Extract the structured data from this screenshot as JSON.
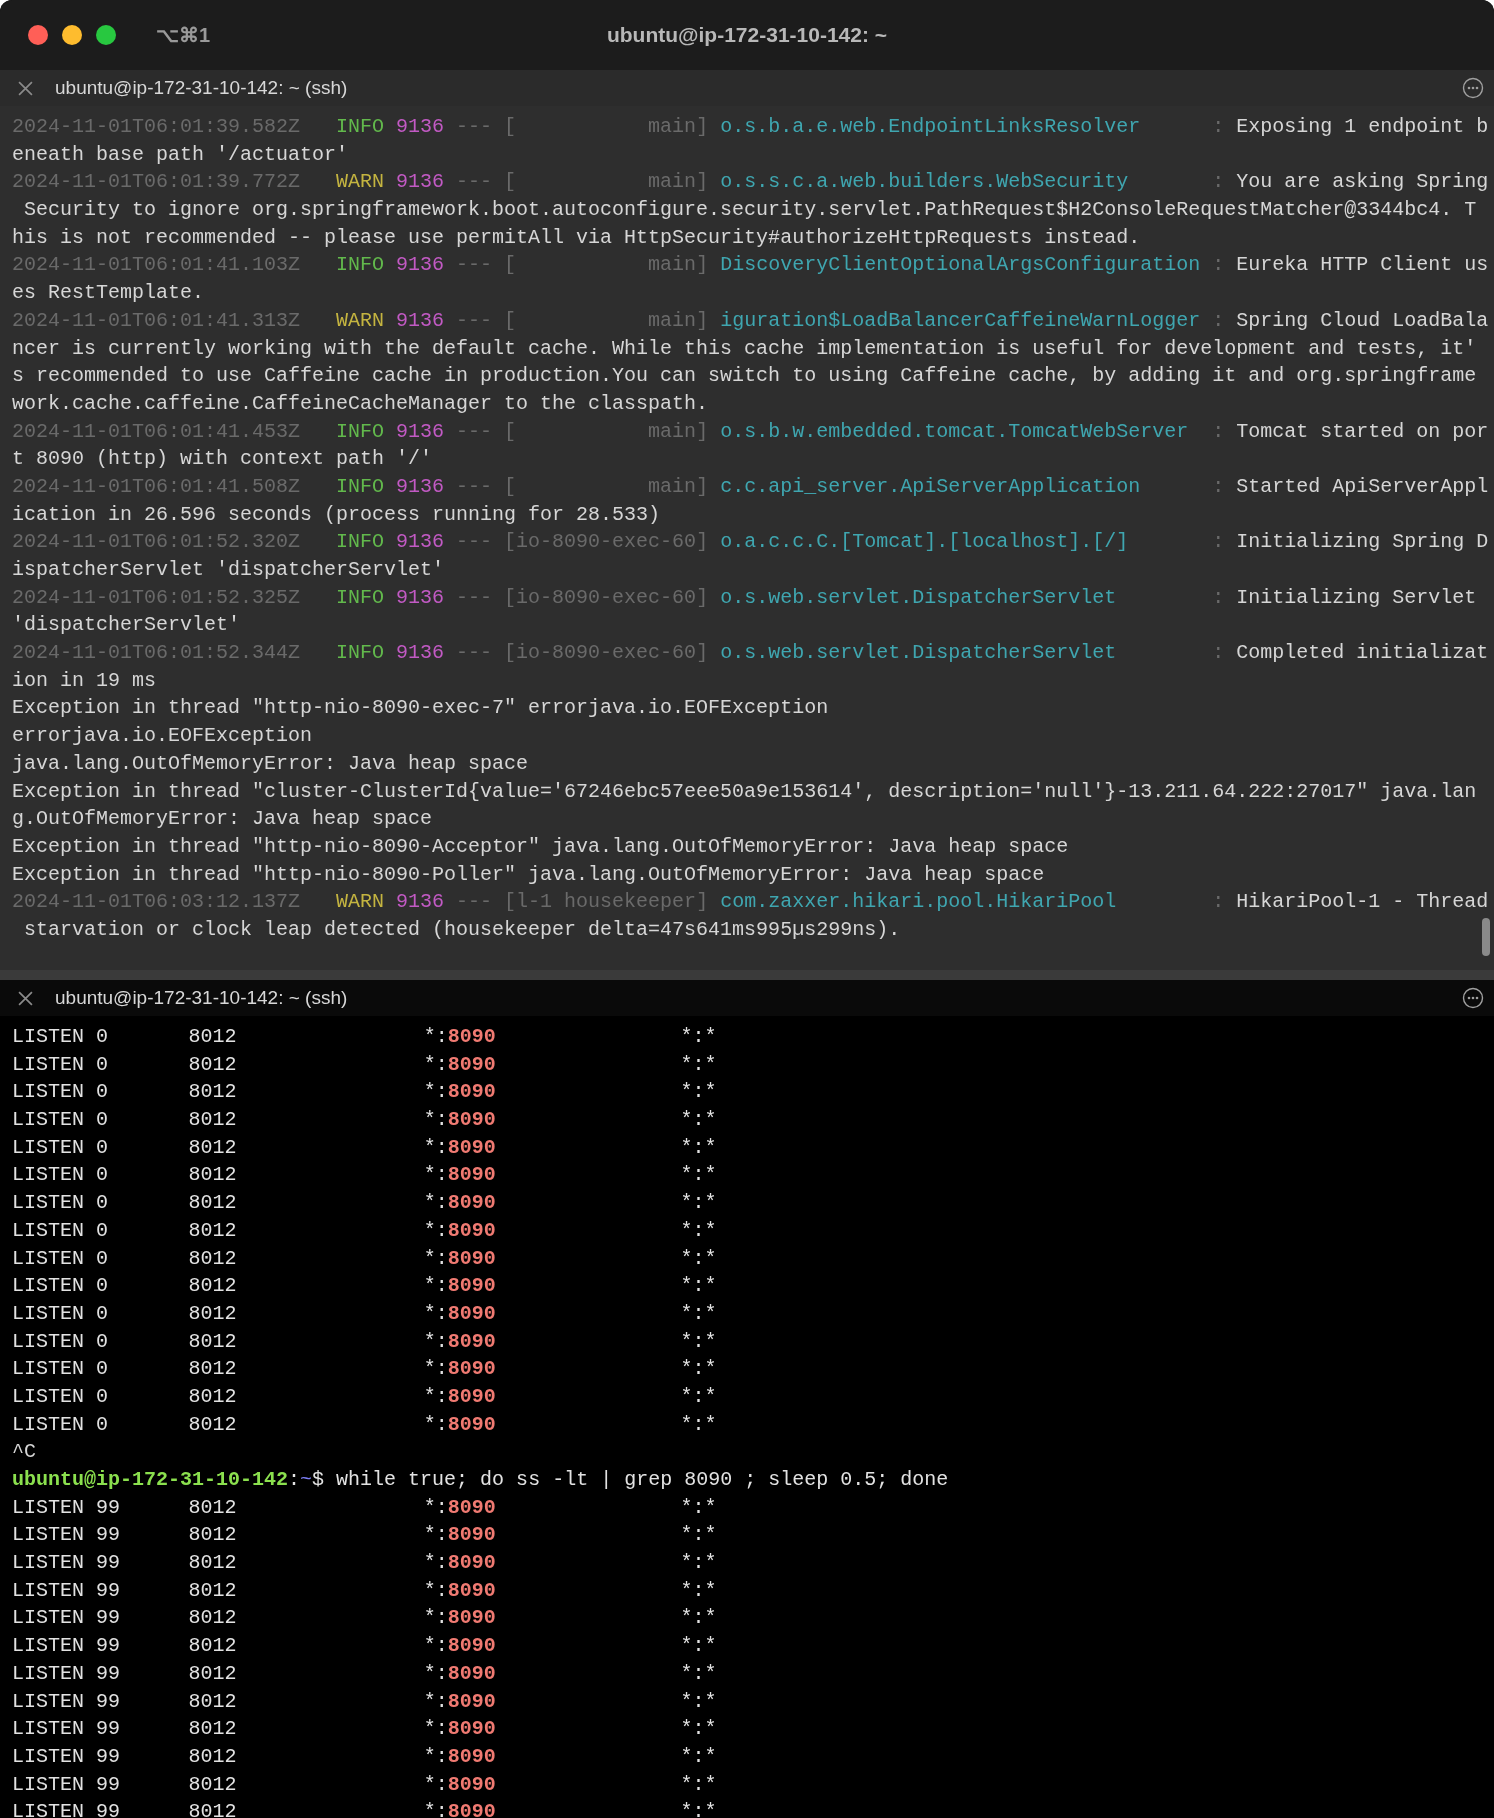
{
  "window": {
    "shortcut": "⌥⌘1",
    "title": "ubuntu@ip-172-31-10-142: ~"
  },
  "panes": [
    {
      "title": "ubuntu@ip-172-31-10-142: ~ (ssh)",
      "rows": [
        {
          "kind": "log",
          "timestamp": "2024-11-01T06:01:39.582Z",
          "level": "INFO",
          "pid": "9136",
          "separator": "---",
          "thread": "[           main]",
          "logger": "o.s.b.a.e.web.EndpointLinksResolver",
          "colon": ":",
          "message": "Exposing 1 endpoint b"
        },
        {
          "kind": "text",
          "text": "eneath base path '/actuator'"
        },
        {
          "kind": "log",
          "timestamp": "2024-11-01T06:01:39.772Z",
          "level": "WARN",
          "pid": "9136",
          "separator": "---",
          "thread": "[           main]",
          "logger": "o.s.s.c.a.web.builders.WebSecurity",
          "colon": ":",
          "message": "You are asking Spring"
        },
        {
          "kind": "text",
          "text": " Security to ignore org.springframework.boot.autoconfigure.security.servlet.PathRequest$H2ConsoleRequestMatcher@3344bc4. T"
        },
        {
          "kind": "text",
          "text": "his is not recommended -- please use permitAll via HttpSecurity#authorizeHttpRequests instead."
        },
        {
          "kind": "log",
          "timestamp": "2024-11-01T06:01:41.103Z",
          "level": "INFO",
          "pid": "9136",
          "separator": "---",
          "thread": "[           main]",
          "logger": "DiscoveryClientOptionalArgsConfiguration",
          "colon": ":",
          "message": "Eureka HTTP Client us"
        },
        {
          "kind": "text",
          "text": "es RestTemplate."
        },
        {
          "kind": "log",
          "timestamp": "2024-11-01T06:01:41.313Z",
          "level": "WARN",
          "pid": "9136",
          "separator": "---",
          "thread": "[           main]",
          "logger": "iguration$LoadBalancerCaffeineWarnLogger",
          "colon": ":",
          "message": "Spring Cloud LoadBala"
        },
        {
          "kind": "text",
          "text": "ncer is currently working with the default cache. While this cache implementation is useful for development and tests, it'"
        },
        {
          "kind": "text",
          "text": "s recommended to use Caffeine cache in production.You can switch to using Caffeine cache, by adding it and org.springframe"
        },
        {
          "kind": "text",
          "text": "work.cache.caffeine.CaffeineCacheManager to the classpath."
        },
        {
          "kind": "log",
          "timestamp": "2024-11-01T06:01:41.453Z",
          "level": "INFO",
          "pid": "9136",
          "separator": "---",
          "thread": "[           main]",
          "logger": "o.s.b.w.embedded.tomcat.TomcatWebServer",
          "colon": ":",
          "message": "Tomcat started on por"
        },
        {
          "kind": "text",
          "text": "t 8090 (http) with context path '/'"
        },
        {
          "kind": "log",
          "timestamp": "2024-11-01T06:01:41.508Z",
          "level": "INFO",
          "pid": "9136",
          "separator": "---",
          "thread": "[           main]",
          "logger": "c.c.api_server.ApiServerApplication",
          "colon": ":",
          "message": "Started ApiServerAppl"
        },
        {
          "kind": "text",
          "text": "ication in 26.596 seconds (process running for 28.533)"
        },
        {
          "kind": "log",
          "timestamp": "2024-11-01T06:01:52.320Z",
          "level": "INFO",
          "pid": "9136",
          "separator": "---",
          "thread": "[io-8090-exec-60]",
          "logger": "o.a.c.c.C.[Tomcat].[localhost].[/]",
          "colon": ":",
          "message": "Initializing Spring D"
        },
        {
          "kind": "text",
          "text": "ispatcherServlet 'dispatcherServlet'"
        },
        {
          "kind": "log",
          "timestamp": "2024-11-01T06:01:52.325Z",
          "level": "INFO",
          "pid": "9136",
          "separator": "---",
          "thread": "[io-8090-exec-60]",
          "logger": "o.s.web.servlet.DispatcherServlet",
          "colon": ":",
          "message": "Initializing Servlet"
        },
        {
          "kind": "text",
          "text": "'dispatcherServlet'"
        },
        {
          "kind": "log",
          "timestamp": "2024-11-01T06:01:52.344Z",
          "level": "INFO",
          "pid": "9136",
          "separator": "---",
          "thread": "[io-8090-exec-60]",
          "logger": "o.s.web.servlet.DispatcherServlet",
          "colon": ":",
          "message": "Completed initializat"
        },
        {
          "kind": "text",
          "text": "ion in 19 ms"
        },
        {
          "kind": "text",
          "text": "Exception in thread \"http-nio-8090-exec-7\" errorjava.io.EOFException"
        },
        {
          "kind": "text",
          "text": "errorjava.io.EOFException"
        },
        {
          "kind": "text",
          "text": "java.lang.OutOfMemoryError: Java heap space"
        },
        {
          "kind": "text",
          "text": "Exception in thread \"cluster-ClusterId{value='67246ebc57eee50a9e153614', description='null'}-13.211.64.222:27017\" java.lan"
        },
        {
          "kind": "text",
          "text": "g.OutOfMemoryError: Java heap space"
        },
        {
          "kind": "text",
          "text": "Exception in thread \"http-nio-8090-Acceptor\" java.lang.OutOfMemoryError: Java heap space"
        },
        {
          "kind": "text",
          "text": "Exception in thread \"http-nio-8090-Poller\" java.lang.OutOfMemoryError: Java heap space"
        },
        {
          "kind": "log",
          "timestamp": "2024-11-01T06:03:12.137Z",
          "level": "WARN",
          "pid": "9136",
          "separator": "---",
          "thread": "[l-1 housekeeper]",
          "logger": "com.zaxxer.hikari.pool.HikariPool",
          "colon": ":",
          "message": "HikariPool-1 - Thread"
        },
        {
          "kind": "text",
          "text": " starvation or clock leap detected (housekeeper delta=47s641ms995µs299ns)."
        }
      ]
    },
    {
      "title": "ubuntu@ip-172-31-10-142: ~ (ssh)",
      "rows": [
        {
          "kind": "socket",
          "state": "LISTEN",
          "recv": "0",
          "send": "8012",
          "wildcard": "*:",
          "port": "8090",
          "peer": "*:*"
        },
        {
          "kind": "socket",
          "state": "LISTEN",
          "recv": "0",
          "send": "8012",
          "wildcard": "*:",
          "port": "8090",
          "peer": "*:*"
        },
        {
          "kind": "socket",
          "state": "LISTEN",
          "recv": "0",
          "send": "8012",
          "wildcard": "*:",
          "port": "8090",
          "peer": "*:*"
        },
        {
          "kind": "socket",
          "state": "LISTEN",
          "recv": "0",
          "send": "8012",
          "wildcard": "*:",
          "port": "8090",
          "peer": "*:*"
        },
        {
          "kind": "socket",
          "state": "LISTEN",
          "recv": "0",
          "send": "8012",
          "wildcard": "*:",
          "port": "8090",
          "peer": "*:*"
        },
        {
          "kind": "socket",
          "state": "LISTEN",
          "recv": "0",
          "send": "8012",
          "wildcard": "*:",
          "port": "8090",
          "peer": "*:*"
        },
        {
          "kind": "socket",
          "state": "LISTEN",
          "recv": "0",
          "send": "8012",
          "wildcard": "*:",
          "port": "8090",
          "peer": "*:*"
        },
        {
          "kind": "socket",
          "state": "LISTEN",
          "recv": "0",
          "send": "8012",
          "wildcard": "*:",
          "port": "8090",
          "peer": "*:*"
        },
        {
          "kind": "socket",
          "state": "LISTEN",
          "recv": "0",
          "send": "8012",
          "wildcard": "*:",
          "port": "8090",
          "peer": "*:*"
        },
        {
          "kind": "socket",
          "state": "LISTEN",
          "recv": "0",
          "send": "8012",
          "wildcard": "*:",
          "port": "8090",
          "peer": "*:*"
        },
        {
          "kind": "socket",
          "state": "LISTEN",
          "recv": "0",
          "send": "8012",
          "wildcard": "*:",
          "port": "8090",
          "peer": "*:*"
        },
        {
          "kind": "socket",
          "state": "LISTEN",
          "recv": "0",
          "send": "8012",
          "wildcard": "*:",
          "port": "8090",
          "peer": "*:*"
        },
        {
          "kind": "socket",
          "state": "LISTEN",
          "recv": "0",
          "send": "8012",
          "wildcard": "*:",
          "port": "8090",
          "peer": "*:*"
        },
        {
          "kind": "socket",
          "state": "LISTEN",
          "recv": "0",
          "send": "8012",
          "wildcard": "*:",
          "port": "8090",
          "peer": "*:*"
        },
        {
          "kind": "socket",
          "state": "LISTEN",
          "recv": "0",
          "send": "8012",
          "wildcard": "*:",
          "port": "8090",
          "peer": "*:*"
        },
        {
          "kind": "text",
          "text": "^C"
        },
        {
          "kind": "prompt",
          "user_host": "ubuntu@ip-172-31-10-142",
          "separator": ":",
          "path": "~",
          "symbol": "$",
          "command": "while true; do ss -lt | grep 8090 ; sleep 0.5; done"
        },
        {
          "kind": "socket",
          "state": "LISTEN",
          "recv": "99",
          "send": "8012",
          "wildcard": "*:",
          "port": "8090",
          "peer": "*:*"
        },
        {
          "kind": "socket",
          "state": "LISTEN",
          "recv": "99",
          "send": "8012",
          "wildcard": "*:",
          "port": "8090",
          "peer": "*:*"
        },
        {
          "kind": "socket",
          "state": "LISTEN",
          "recv": "99",
          "send": "8012",
          "wildcard": "*:",
          "port": "8090",
          "peer": "*:*"
        },
        {
          "kind": "socket",
          "state": "LISTEN",
          "recv": "99",
          "send": "8012",
          "wildcard": "*:",
          "port": "8090",
          "peer": "*:*"
        },
        {
          "kind": "socket",
          "state": "LISTEN",
          "recv": "99",
          "send": "8012",
          "wildcard": "*:",
          "port": "8090",
          "peer": "*:*"
        },
        {
          "kind": "socket",
          "state": "LISTEN",
          "recv": "99",
          "send": "8012",
          "wildcard": "*:",
          "port": "8090",
          "peer": "*:*"
        },
        {
          "kind": "socket",
          "state": "LISTEN",
          "recv": "99",
          "send": "8012",
          "wildcard": "*:",
          "port": "8090",
          "peer": "*:*"
        },
        {
          "kind": "socket",
          "state": "LISTEN",
          "recv": "99",
          "send": "8012",
          "wildcard": "*:",
          "port": "8090",
          "peer": "*:*"
        },
        {
          "kind": "socket",
          "state": "LISTEN",
          "recv": "99",
          "send": "8012",
          "wildcard": "*:",
          "port": "8090",
          "peer": "*:*"
        },
        {
          "kind": "socket",
          "state": "LISTEN",
          "recv": "99",
          "send": "8012",
          "wildcard": "*:",
          "port": "8090",
          "peer": "*:*"
        },
        {
          "kind": "socket",
          "state": "LISTEN",
          "recv": "99",
          "send": "8012",
          "wildcard": "*:",
          "port": "8090",
          "peer": "*:*"
        },
        {
          "kind": "socket",
          "state": "LISTEN",
          "recv": "99",
          "send": "8012",
          "wildcard": "*:",
          "port": "8090",
          "peer": "*:*"
        }
      ]
    }
  ]
}
